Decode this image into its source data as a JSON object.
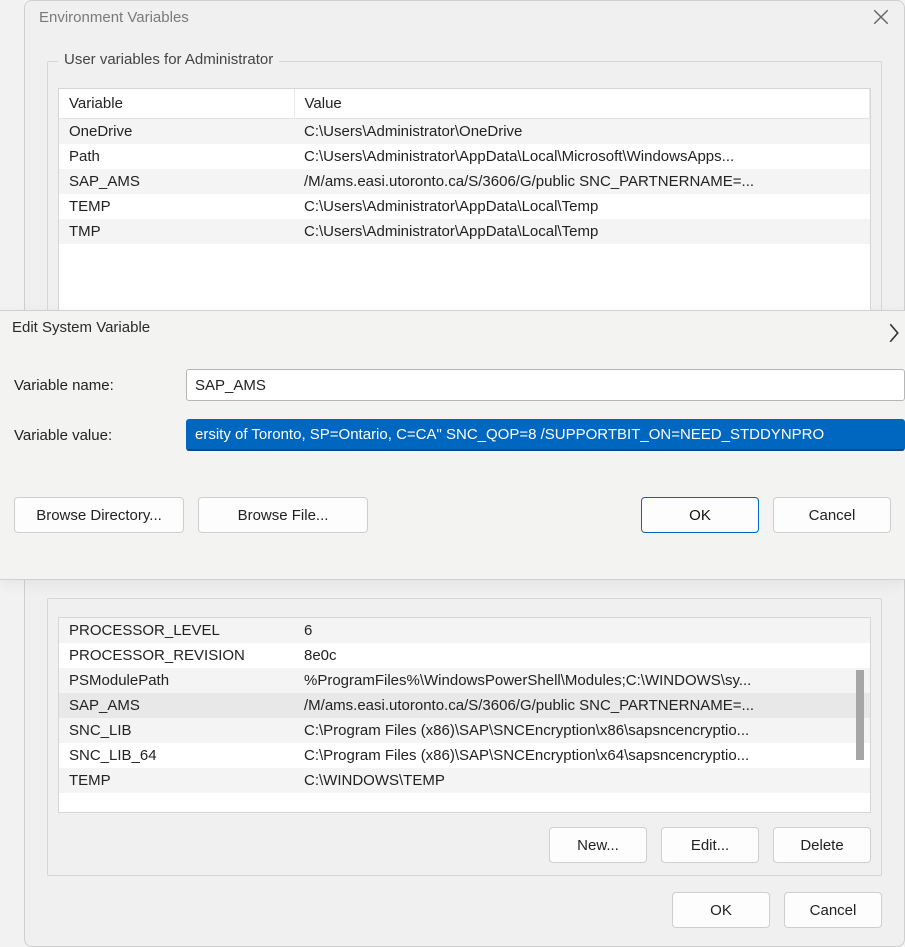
{
  "env_dialog": {
    "title": "Environment Variables",
    "user_group_label": "User variables for Administrator",
    "columns": {
      "variable": "Variable",
      "value": "Value"
    },
    "user_vars": [
      {
        "name": "OneDrive",
        "value": "C:\\Users\\Administrator\\OneDrive"
      },
      {
        "name": "Path",
        "value": "C:\\Users\\Administrator\\AppData\\Local\\Microsoft\\WindowsApps..."
      },
      {
        "name": "SAP_AMS",
        "value": "/M/ams.easi.utoronto.ca/S/3606/G/public SNC_PARTNERNAME=..."
      },
      {
        "name": "TEMP",
        "value": "C:\\Users\\Administrator\\AppData\\Local\\Temp"
      },
      {
        "name": "TMP",
        "value": "C:\\Users\\Administrator\\AppData\\Local\\Temp"
      }
    ],
    "system_vars": [
      {
        "name": "PROCESSOR_LEVEL",
        "value": "6"
      },
      {
        "name": "PROCESSOR_REVISION",
        "value": "8e0c"
      },
      {
        "name": "PSModulePath",
        "value": "%ProgramFiles%\\WindowsPowerShell\\Modules;C:\\WINDOWS\\sy..."
      },
      {
        "name": "SAP_AMS",
        "value": "/M/ams.easi.utoronto.ca/S/3606/G/public SNC_PARTNERNAME=..."
      },
      {
        "name": "SNC_LIB",
        "value": "C:\\Program Files (x86)\\SAP\\SNCEncryption\\x86\\sapsncencryptio..."
      },
      {
        "name": "SNC_LIB_64",
        "value": "C:\\Program Files (x86)\\SAP\\SNCEncryption\\x64\\sapsncencryptio..."
      },
      {
        "name": "TEMP",
        "value": "C:\\WINDOWS\\TEMP"
      }
    ],
    "buttons": {
      "new": "New...",
      "edit": "Edit...",
      "delete": "Delete",
      "ok": "OK",
      "cancel": "Cancel"
    }
  },
  "edit_dialog": {
    "title": "Edit System Variable",
    "labels": {
      "name": "Variable name:",
      "value": "Variable value:"
    },
    "fields": {
      "name": "SAP_AMS",
      "value": "ersity of Toronto, SP=Ontario, C=CA\" SNC_QOP=8 /SUPPORTBIT_ON=NEED_STDDYNPRO"
    },
    "buttons": {
      "browse_dir": "Browse Directory...",
      "browse_file": "Browse File...",
      "ok": "OK",
      "cancel": "Cancel"
    }
  }
}
